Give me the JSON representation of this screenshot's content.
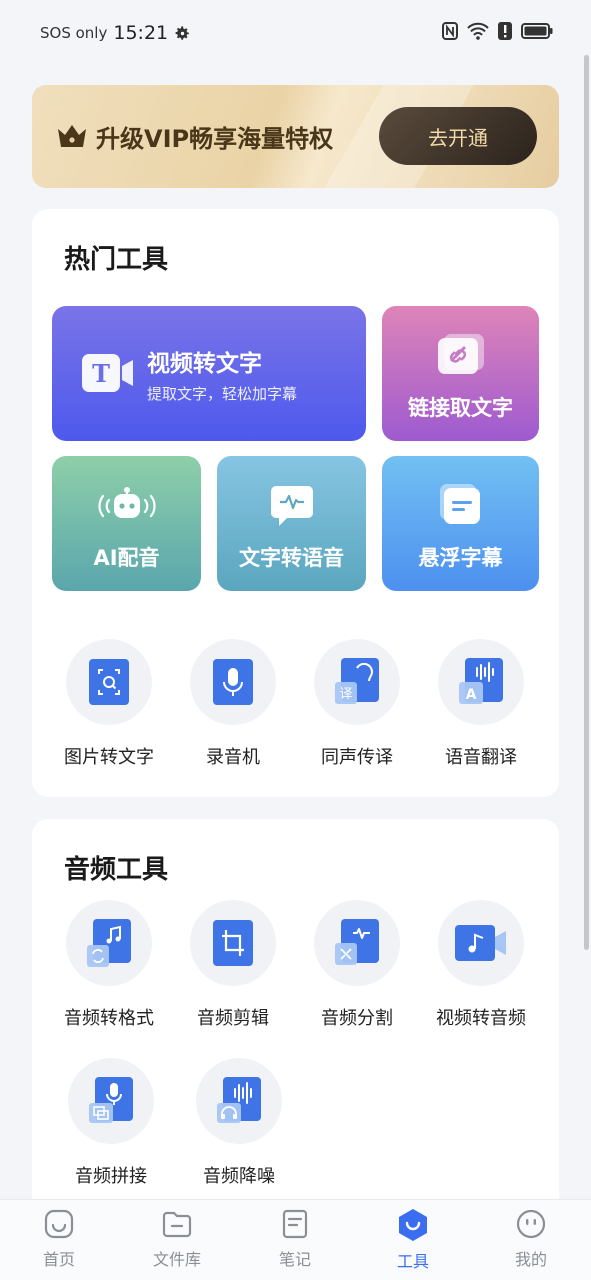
{
  "status": {
    "carrier": "SOS only",
    "time": "15:21"
  },
  "vip": {
    "text": "升级VIP畅享海量特权",
    "button": "去开通"
  },
  "hot_tools": {
    "title": "热门工具",
    "video_to_text": {
      "label": "视频转文字",
      "sub": "提取文字，轻松加字幕"
    },
    "link_to_text": "链接取文字",
    "ai_dubbing": "AI配音",
    "text_to_speech": "文字转语音",
    "floating_subtitle": "悬浮字幕",
    "grid": [
      "图片转文字",
      "录音机",
      "同声传译",
      "语音翻译"
    ]
  },
  "audio_tools": {
    "title": "音频工具",
    "row1": [
      "音频转格式",
      "音频剪辑",
      "音频分割",
      "视频转音频"
    ],
    "row2": [
      "音频拼接",
      "音频降噪"
    ]
  },
  "nav": {
    "items": [
      "首页",
      "文件库",
      "笔记",
      "工具",
      "我的"
    ],
    "active": "工具"
  },
  "colors": {
    "accent": "#3b6df0",
    "vip_text": "#4a3618",
    "vip_button_text": "#f1d9a8"
  }
}
